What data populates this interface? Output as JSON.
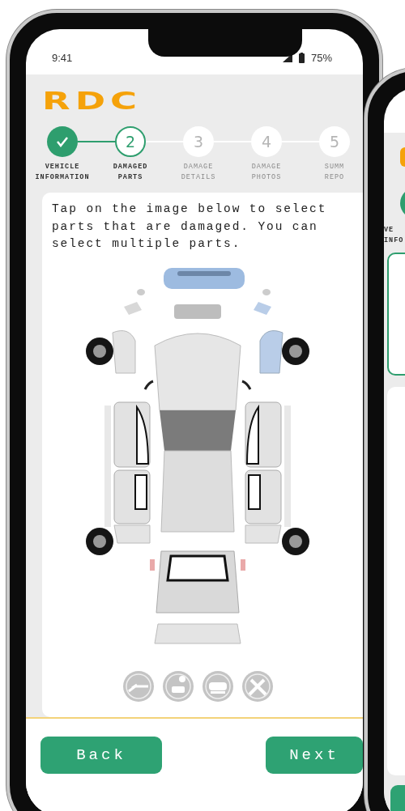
{
  "status_bar": {
    "time": "9:41",
    "battery": "75%"
  },
  "logo": "RDC",
  "steps": [
    {
      "kind": "done",
      "label": [
        "VEHICLE",
        "INFORMATION"
      ]
    },
    {
      "kind": "current",
      "number": "2",
      "label": [
        "DAMAGED",
        "PARTS"
      ]
    },
    {
      "kind": "upcoming",
      "number": "3",
      "label": [
        "DAMAGE",
        "DETAILS"
      ]
    },
    {
      "kind": "upcoming",
      "number": "4",
      "label": [
        "DAMAGE",
        "PHOTOS"
      ]
    },
    {
      "kind": "upcoming",
      "number": "5",
      "label": [
        "SUMM",
        "REPO"
      ]
    }
  ],
  "instruction": "Tap on the image below to select parts that are damaged. You can select multiple parts.",
  "buttons": [
    {
      "kind": "back",
      "label": "Back"
    },
    {
      "kind": "next",
      "label": "Next"
    }
  ],
  "second_phone": {
    "step_label": [
      "VE",
      "INFO"
    ]
  }
}
